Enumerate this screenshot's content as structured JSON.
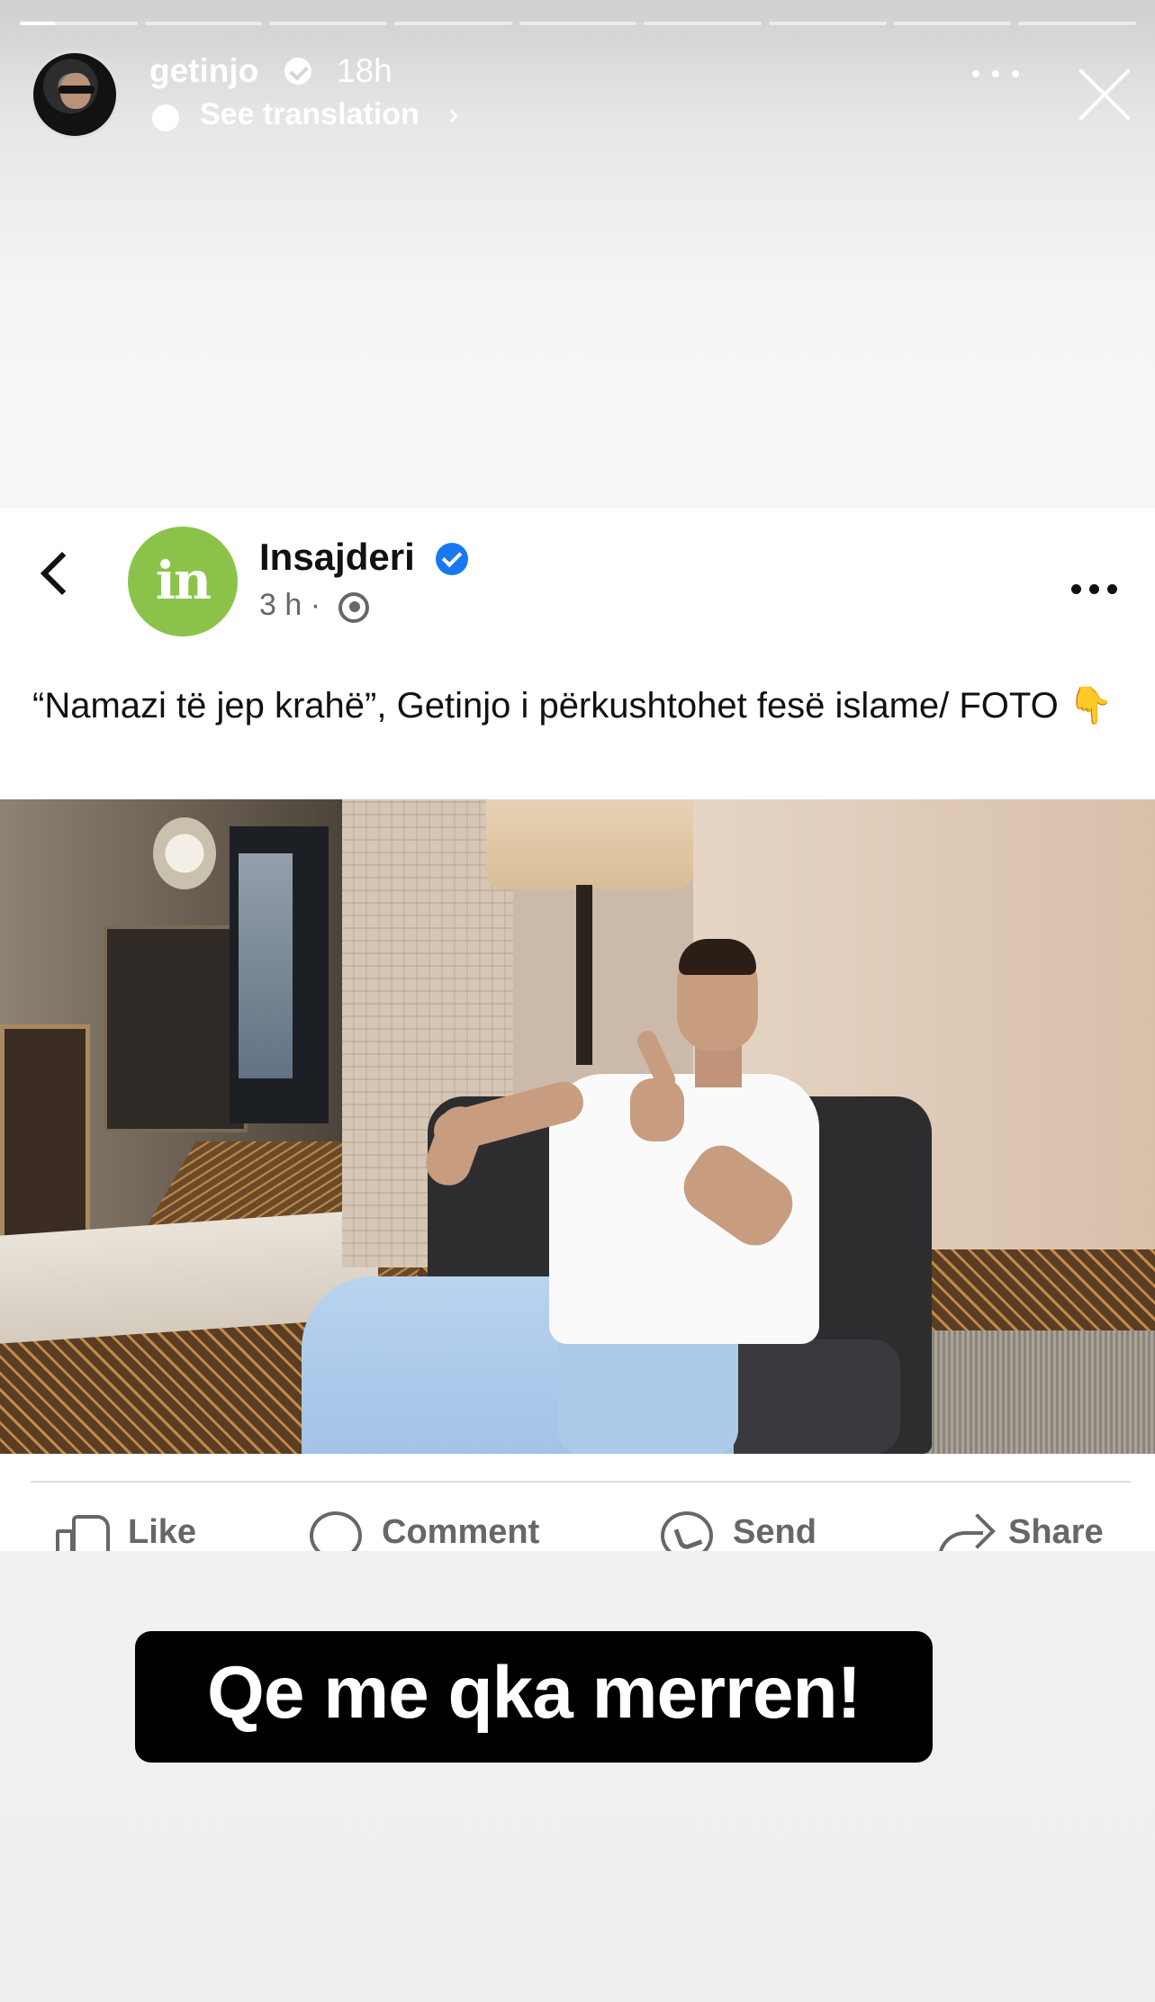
{
  "story": {
    "progress_segments": 9,
    "active_segment": 1,
    "active_progress": 0.3,
    "username": "getinjo",
    "verified": true,
    "age": "18h",
    "translation_link": "See translation",
    "translation_chevron": "›",
    "caption": "Qe me qka merren!"
  },
  "post": {
    "page_name": "Insajderi",
    "page_logo_text": "in",
    "verified": true,
    "time": "3 h ·",
    "text": "“Namazi të jep krahë”, Getinjo i përkushtohet fesë islame/ FOTO",
    "text_emoji": "👇",
    "actions": [
      {
        "label": "Like",
        "icon": "thumbs-up-icon"
      },
      {
        "label": "Comment",
        "icon": "comment-bubble-icon"
      },
      {
        "label": "Send",
        "icon": "messenger-icon"
      },
      {
        "label": "Share",
        "icon": "share-arrow-icon"
      }
    ]
  },
  "colors": {
    "accent_green": "#8bc34a",
    "facebook_blue": "#1877f2",
    "muted_text": "#65676b",
    "caption_bg": "#000000"
  }
}
